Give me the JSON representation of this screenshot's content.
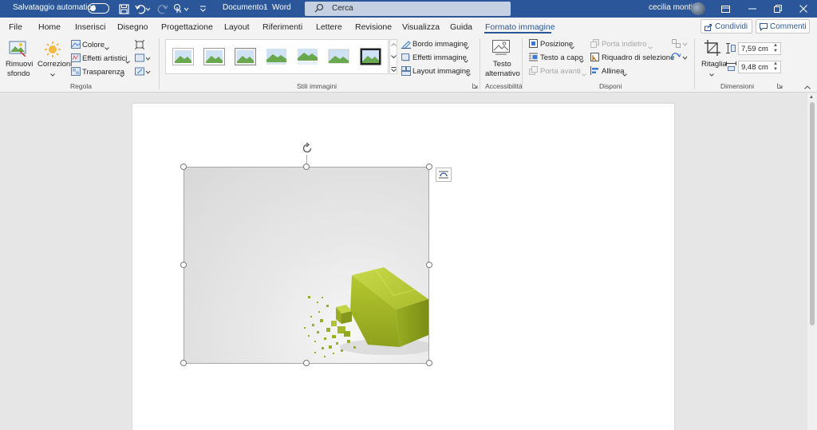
{
  "titlebar": {
    "autosave_label": "Salvataggio automatico",
    "doc_title": "Documento1",
    "separator": "-",
    "app_name": "Word",
    "search_placeholder": "Cerca",
    "user_name": "cecilia monti"
  },
  "menu": {
    "tabs": [
      "File",
      "Home",
      "Inserisci",
      "Disegno",
      "Progettazione",
      "Layout",
      "Riferimenti",
      "Lettere",
      "Revisione",
      "Visualizza",
      "Guida",
      "Formato immagine"
    ],
    "active_tab": "Formato immagine",
    "share_label": "Condividi",
    "comments_label": "Commenti"
  },
  "ribbon": {
    "regola": {
      "title": "Regola",
      "remove_bg_line1": "Rimuovi",
      "remove_bg_line2": "sfondo",
      "corrections": "Correzioni",
      "color": "Colore",
      "artistic_effects": "Effetti artistici",
      "transparency": "Trasparenza"
    },
    "stili": {
      "title": "Stili immagini",
      "border": "Bordo immagine",
      "effects": "Effetti immagine",
      "layout": "Layout immagine"
    },
    "accessibilita": {
      "title": "Accessibilità",
      "alt_text_line1": "Testo",
      "alt_text_line2": "alternativo"
    },
    "disponi": {
      "title": "Disponi",
      "position": "Posizione",
      "wrap_text": "Testo a capo",
      "bring_forward": "Porta avanti",
      "send_backward": "Porta indietro",
      "selection_pane": "Riquadro di selezione",
      "align": "Allinea"
    },
    "dimensioni": {
      "title": "Dimensioni",
      "crop": "Ritaglia",
      "height": "7,59 cm",
      "width": "9,48 cm"
    }
  },
  "colors": {
    "accent": "#2b579a",
    "ribbon_bg": "#f3f3f3",
    "doc_bg": "#e6e6e6",
    "cube_green": "#a4b82a"
  }
}
